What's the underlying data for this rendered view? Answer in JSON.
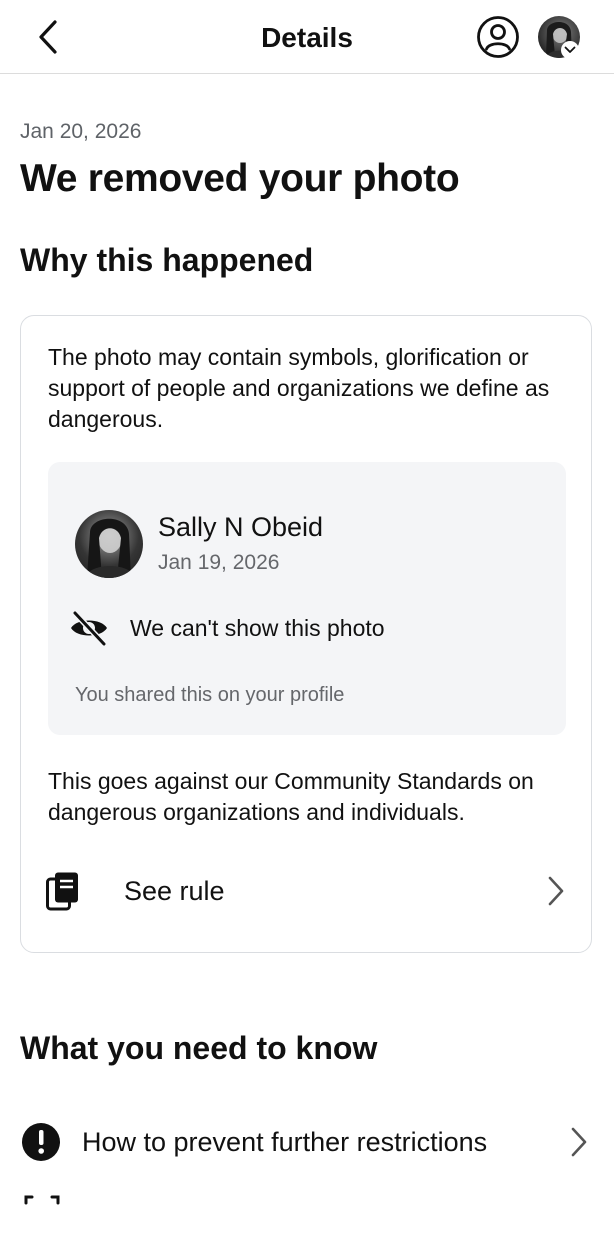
{
  "header": {
    "title": "Details",
    "back_icon": "chevron-left-icon",
    "account_icon": "account-circle-icon",
    "profile_icon": "profile-avatar"
  },
  "notice": {
    "date": "Jan 20, 2026",
    "title": "We removed your photo"
  },
  "why_section": {
    "heading": "Why this happened",
    "description": "The photo may contain symbols, glorification or support of people and organizations we define as dangerous.",
    "post": {
      "author": "Sally N Obeid",
      "date": "Jan 19, 2026",
      "hidden_message": "We can't show this photo",
      "shared_note": "You shared this on your profile"
    },
    "standards_text": "This goes against our Community Standards on dangerous organizations and individuals.",
    "rule_link": {
      "label": "See rule",
      "icon": "rule-book-icon"
    }
  },
  "know_section": {
    "heading": "What you need to know",
    "items": [
      {
        "label": "How to prevent further restrictions",
        "icon": "exclamation-icon"
      }
    ]
  },
  "colors": {
    "text_primary": "#111111",
    "text_secondary": "#65676b",
    "card_border": "#dadde1",
    "post_background": "#f4f5f7"
  }
}
